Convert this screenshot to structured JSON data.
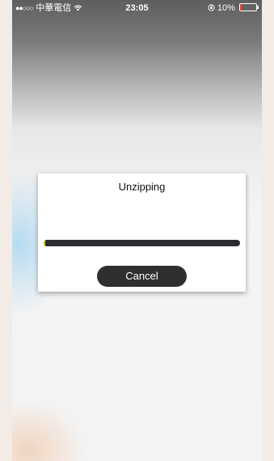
{
  "status_bar": {
    "carrier": "中華電信",
    "time": "23:05",
    "battery_label": "10%",
    "battery_level": 0.1,
    "battery_color": "#ff3b30",
    "wifi_icon": "wifi-icon",
    "lock_icon": "rotation-lock-icon"
  },
  "dialog": {
    "title": "Unzipping",
    "progress": 0.01,
    "progress_color": "#c8d400",
    "cancel_label": "Cancel"
  }
}
